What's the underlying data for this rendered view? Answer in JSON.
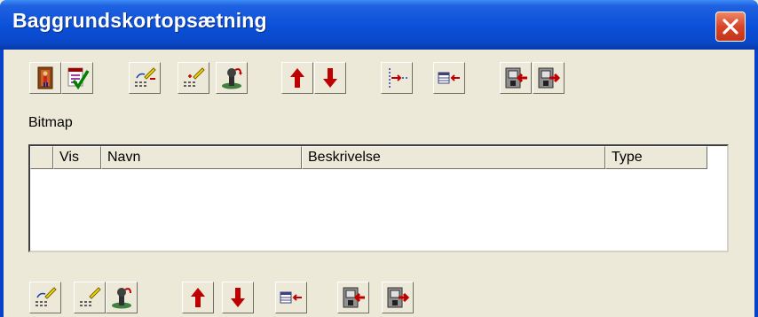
{
  "window": {
    "title": "Baggrundskortopsætning",
    "close_label": "×"
  },
  "toolbar_top": {
    "buttons": [
      {
        "id": "exit",
        "icon": "exit-door-icon"
      },
      {
        "id": "confirm",
        "icon": "checklist-check-icon"
      },
      {
        "id": "edit-grid",
        "icon": "edit-grid-icon"
      },
      {
        "id": "new-grid",
        "icon": "new-grid-icon"
      },
      {
        "id": "joystick-undo",
        "icon": "joystick-undo-icon"
      },
      {
        "id": "move-up",
        "icon": "arrow-up-icon"
      },
      {
        "id": "move-down",
        "icon": "arrow-down-icon"
      },
      {
        "id": "insert-level",
        "icon": "insert-level-icon"
      },
      {
        "id": "insert-column",
        "icon": "insert-column-icon"
      },
      {
        "id": "import",
        "icon": "import-icon"
      },
      {
        "id": "export",
        "icon": "export-icon"
      }
    ]
  },
  "section": {
    "label": "Bitmap"
  },
  "table": {
    "columns": [
      "",
      "Vis",
      "Navn",
      "Beskrivelse",
      "Type"
    ],
    "rows": []
  },
  "toolbar_bottom": {
    "buttons": [
      {
        "id": "edit-grid",
        "icon": "edit-grid-icon"
      },
      {
        "id": "new-grid",
        "icon": "new-grid-icon"
      },
      {
        "id": "joystick-undo",
        "icon": "joystick-undo-icon"
      },
      {
        "id": "move-up",
        "icon": "arrow-up-icon"
      },
      {
        "id": "move-down",
        "icon": "arrow-down-icon"
      },
      {
        "id": "insert-column",
        "icon": "insert-column-icon"
      },
      {
        "id": "import",
        "icon": "import-icon"
      },
      {
        "id": "export",
        "icon": "export-icon"
      }
    ]
  },
  "colors": {
    "titlebar": "#0a4fd8",
    "face": "#ece9d8",
    "close": "#d8452a",
    "arrow": "#c00000"
  }
}
